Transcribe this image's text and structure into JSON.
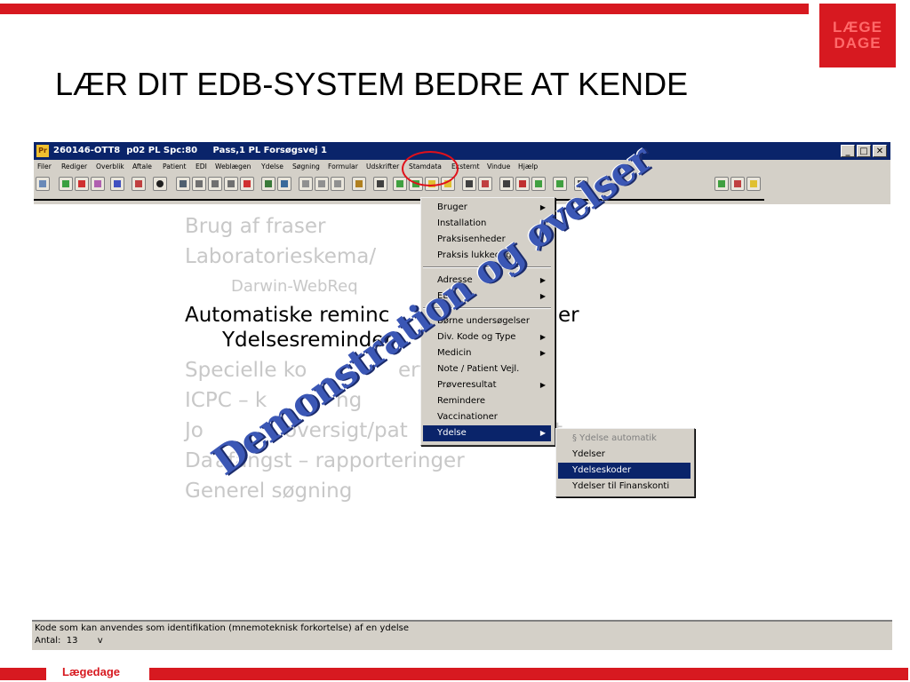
{
  "slide": {
    "title": "LÆR DIT EDB-SYSTEM BEDRE AT KENDE",
    "logo_line1": "LÆGE",
    "logo_line2": "DAGE",
    "footer_label": "Lægedage",
    "overlay_text": "Demonstration og øvelser",
    "bullets": [
      "Brug af fraser",
      "Laboratorieskema/",
      "Darwin-WebReq",
      "Automatiske reminc",
      "er",
      "Ydelsesreminder",
      "Specielle ko",
      "erf",
      "ICPC – k",
      "ng",
      "Jo",
      "oversigt/pat",
      "t",
      "Da",
      "afangst – rapporteringer",
      "Generel søgning"
    ]
  },
  "window": {
    "icon_label": "Pr",
    "title": "260146-OTT8  p02 PL Spc:80     Pass,1 PL Forsøgsvej 1",
    "buttons": {
      "minimize": "_",
      "maximize": "□",
      "close": "✕"
    },
    "menubar": [
      "Filer",
      "Rediger",
      "Overblik",
      "Aftale",
      "Patient",
      "EDI",
      "Weblægen",
      "Ydelse",
      "Søgning",
      "Formular",
      "Udskrifter",
      "Stamdata",
      "Eksternt",
      "Vindue",
      "Hjælp"
    ]
  },
  "stamdata_menu": {
    "items": [
      {
        "label": "Bruger",
        "submenu": true
      },
      {
        "label": "Installation",
        "submenu": false
      },
      {
        "label": "Praksisenheder",
        "submenu": false
      },
      {
        "label": "Praksis lukkedage",
        "submenu": false
      },
      {
        "label": "Adresse",
        "submenu": true
      },
      {
        "label": "EDI",
        "submenu": true
      },
      {
        "label": "Børne undersøgelser",
        "submenu": false
      },
      {
        "label": "Div. Kode og Type",
        "submenu": true
      },
      {
        "label": "Medicin",
        "submenu": true
      },
      {
        "label": "Note / Patient Vejl.",
        "submenu": false
      },
      {
        "label": "Prøveresultat",
        "submenu": true
      },
      {
        "label": "Remindere",
        "submenu": false
      },
      {
        "label": "Vaccinationer",
        "submenu": false
      },
      {
        "label": "Ydelse",
        "submenu": true,
        "selected": true
      }
    ]
  },
  "ydelse_submenu": {
    "items": [
      {
        "label": "§ Ydelse automatik",
        "disabled": true
      },
      {
        "label": "Ydelser"
      },
      {
        "label": "Ydelseskoder",
        "selected": true
      },
      {
        "label": "Ydelser til Finanskonti"
      }
    ]
  },
  "statusbar": {
    "description": "Kode som kan anvendes som identifikation (mnemoteknisk forkortelse) af en ydelse",
    "count_line": "Antal:  13       v"
  },
  "colors": {
    "accent_red": "#d71920",
    "titlebar_blue": "#0a246a",
    "overlay_blue": "#3b57b5"
  }
}
